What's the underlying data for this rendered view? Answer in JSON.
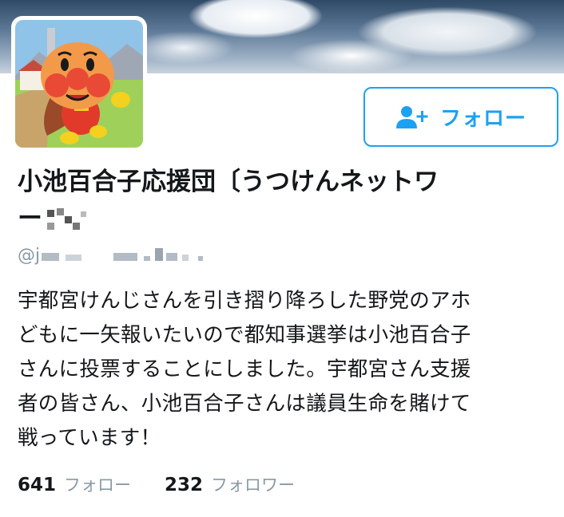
{
  "profile": {
    "display_name_line1": "小池百合子応援団〔うつけんネットワ",
    "display_name_line2": "ー",
    "handle_prefix": "@j",
    "follow_button_label": "フォロー",
    "bio_lines": [
      "宇都宮けんじさんを引き摺り降ろした野党のアホ",
      "どもに一矢報いたいので都知事選挙は小池百合子",
      "さんに投票することにしました。宇都宮さん支援",
      "者の皆さん、小池百合子さんは議員生命を賭けて",
      "戦っています！"
    ]
  },
  "stats": {
    "following_count": "641",
    "following_label": "フォロー",
    "followers_count": "232",
    "followers_label": "フォロワー"
  },
  "colors": {
    "accent": "#1da1f2",
    "text_primary": "#14171a",
    "text_secondary": "#8899a6"
  },
  "icons": {
    "follow": "add-user-icon",
    "avatar": "anpanman-character-avatar"
  }
}
